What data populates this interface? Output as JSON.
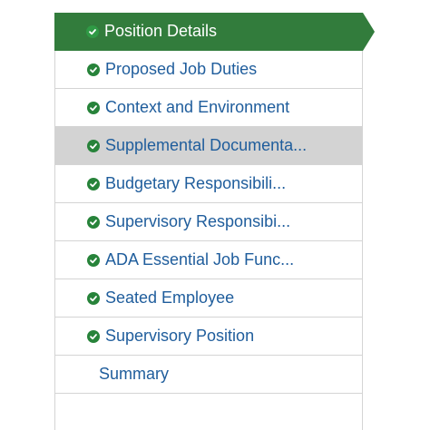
{
  "nav": {
    "items": [
      {
        "label": "Position Details",
        "completed": true,
        "state": "active"
      },
      {
        "label": "Proposed Job Duties",
        "completed": true,
        "state": "normal"
      },
      {
        "label": "Context and Environment",
        "completed": true,
        "state": "normal"
      },
      {
        "label": "Supplemental Documenta...",
        "completed": true,
        "state": "hover"
      },
      {
        "label": "Budgetary Responsibili...",
        "completed": true,
        "state": "normal"
      },
      {
        "label": "Supervisory Responsibi...",
        "completed": true,
        "state": "normal"
      },
      {
        "label": "ADA Essential Job Func...",
        "completed": true,
        "state": "normal"
      },
      {
        "label": "Seated Employee",
        "completed": true,
        "state": "normal"
      },
      {
        "label": "Supervisory Position",
        "completed": true,
        "state": "normal"
      },
      {
        "label": "Summary",
        "completed": false,
        "state": "normal"
      }
    ]
  },
  "colors": {
    "active_background": "#327c3c",
    "hover_background": "#d3d3d3",
    "check_green": "#27833a",
    "link_text": "#1f5d9c",
    "border": "#d4d4d4"
  },
  "icons": {
    "completed": "check-circle-icon"
  }
}
